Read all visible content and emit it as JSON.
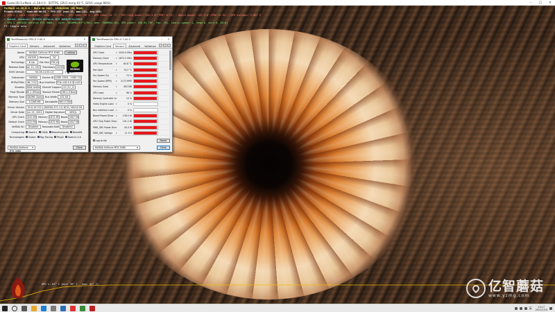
{
  "furmark": {
    "window_title": "Geeks3D FurMark v1.28.0.0 - [DTTPS, GPU1 temp:61°C, GPU1 usage:98%]",
    "lines": [
      "FurMark v1.28.0.0 - Burn-in test, 1920x1080 (0X MSAA)",
      "Frames:63842 - time:00:06:51 - FPS:157 (min:32, max:211, avg:155)",
      "[ GPU-Z ] core: 1620 MHz - mem: 1875 MHz - GPU load: 98 % - GPU temp: 61 °C - GPU chip power: 105.1 W (PPW: 0.75) - Board power: 147.2 W (PPW: 0.70) - GPU voltage: 1.087 V",
      "> OpenGL renderer: NVIDIA GeForce RTX 3060/PCIe/SSE2",
      "> GPU 1 (NVIDIA GeForce RTX 3060) - core: 1620MHz/61°C/98%, mem: 7500MHz/10%, GPU power: 100.0% TDP, fan: 74%, limits:[power:1, temp:0, volt:0, OV:0]",
      "F1: toggle help"
    ],
    "graph_label": "GPU 1: 61° C (min: 36° C - max: 61° C)"
  },
  "gpuz_main": {
    "title": "TechPowerUp GPU-Z 2.40.0",
    "tabs": [
      "Graphics Card",
      "Sensors",
      "Advanced",
      "Validation"
    ],
    "rows": [
      {
        "label": "Name",
        "value": "NVIDIA GeForce RTX 3060"
      },
      {
        "label": "GPU",
        "value": "GA106",
        "sub": "Revision",
        "value2": "A1"
      },
      {
        "label": "Technology",
        "value": "8 nm",
        "sub": "Die Size",
        "value2": "276 mm²"
      },
      {
        "label": "Release Date",
        "value": "Jan 12, 2021",
        "sub": "Transistors",
        "value2": "12000M"
      },
      {
        "label": "BIOS Version",
        "value": "94.06.14.00.C3",
        "uefi": "UEFI"
      },
      {
        "label": "Subvendor",
        "value": "NVIDIA",
        "sub": "Device ID",
        "value2": "10DE 2503 - 10DE 1522"
      },
      {
        "label": "ROPs/TMUs",
        "value": "48 / 112",
        "sub": "Bus Interface",
        "value2": "PCIe x16 4.0 @ x16 4.0"
      },
      {
        "label": "Shaders",
        "value": "3584 Unified",
        "sub": "DirectX Support",
        "value2": "12 (12_2)"
      },
      {
        "label": "Pixel Fillrate",
        "value": "85.1 GPixel/s",
        "sub": "Texture Fillrate",
        "value2": "198.5 GTexel/s"
      },
      {
        "label": "Memory Type",
        "value": "GDDR6 (Samsung)",
        "sub": "Bus Width",
        "value2": "192 bit"
      },
      {
        "label": "Memory Size",
        "value": "12288 MB",
        "sub": "Bandwidth",
        "value2": "360.0 GB/s"
      },
      {
        "label": "Driver Version",
        "value": "30.0.14.7111 (NVIDIA 471.11) DCH / Win10 64"
      },
      {
        "label": "Driver Date",
        "value": "Jun 21, 2021",
        "sub": "Digital Signature",
        "value2": "WHQL"
      },
      {
        "label": "GPU Clock",
        "value": "1320 MHz",
        "sub": "Memory",
        "value2": "1875 MHz",
        "sub3": "Boost",
        "value3": "1807 MHz"
      },
      {
        "label": "Default Clock",
        "value": "1320 MHz",
        "sub": "Memory",
        "value2": "1875 MHz",
        "sub3": "Boost",
        "value3": "1807 MHz"
      },
      {
        "label": "NVIDIA SLI",
        "value": "Disabled",
        "sub": "Resizable BAR",
        "value2": "Disabled"
      }
    ],
    "lookup_label": "Lookup",
    "computing_label": "Computing",
    "technologies_label": "Technologies",
    "computing": [
      "OpenCL",
      "CUDA",
      "DirectCompute",
      "DirectML"
    ],
    "technologies": [
      "Vulkan",
      "Ray Tracing",
      "PhysX",
      "OpenGL 4.6"
    ],
    "logo_text": "NVIDIA",
    "device_select": "NVIDIA GeForce RTX 3060",
    "close_label": "Close"
  },
  "gpuz_sensors": {
    "title": "TechPowerUp GPU-Z 2.40.0",
    "tabs": [
      "Graphics Card",
      "Sensors",
      "Advanced",
      "Validation"
    ],
    "sensors": [
      {
        "name": "GPU Clock",
        "value": "1530.0 MHz",
        "level": 0.97
      },
      {
        "name": "Memory Clock",
        "value": "1875.2 MHz",
        "level": 0.97
      },
      {
        "name": "GPU Temperature",
        "value": "60.8 °C",
        "level": 0.97
      },
      {
        "name": "Hot Spot",
        "value": "74.2 °C",
        "level": 0.97
      },
      {
        "name": "Fan Speed (%)",
        "value": "74 %",
        "level": 0.97
      },
      {
        "name": "Fan Speed (RPM)",
        "value": "2173 RPM",
        "level": 0.97
      },
      {
        "name": "Memory Used",
        "value": "463 MB",
        "level": 0.97
      },
      {
        "name": "GPU Load",
        "value": "98 %",
        "level": 0.97
      },
      {
        "name": "Memory Controller Load",
        "value": "10 %",
        "level": 0.97
      },
      {
        "name": "Video Engine Load",
        "value": "0 %",
        "level": 0
      },
      {
        "name": "Bus Interface Load",
        "value": "0 %",
        "level": 0
      },
      {
        "name": "Board Power Draw",
        "value": "136.0 W",
        "level": 0.97
      },
      {
        "name": "GPU Chip Power Draw",
        "value": "101.2 W",
        "level": 0.97
      },
      {
        "name": "PWR_SRC Power Draw",
        "value": "40.4 W",
        "level": 0.97
      },
      {
        "name": "PWR_SRC Voltage",
        "value": "11.9 V",
        "level": 0.97
      }
    ],
    "log_to_file": "Log to file",
    "reset_label": "Reset",
    "device_select": "NVIDIA GeForce RTX 3060",
    "close_label": "Close"
  },
  "watermark": {
    "title": "亿智蘑菇",
    "url": "www.yzmg.com"
  },
  "taskbar": {
    "time": "23:17",
    "date": "2021/7/16",
    "lang": "英"
  },
  "colors": {
    "sensor_bar": "#e8161a",
    "nvidia_green": "#76b900",
    "graph_line": "#f0c000"
  }
}
